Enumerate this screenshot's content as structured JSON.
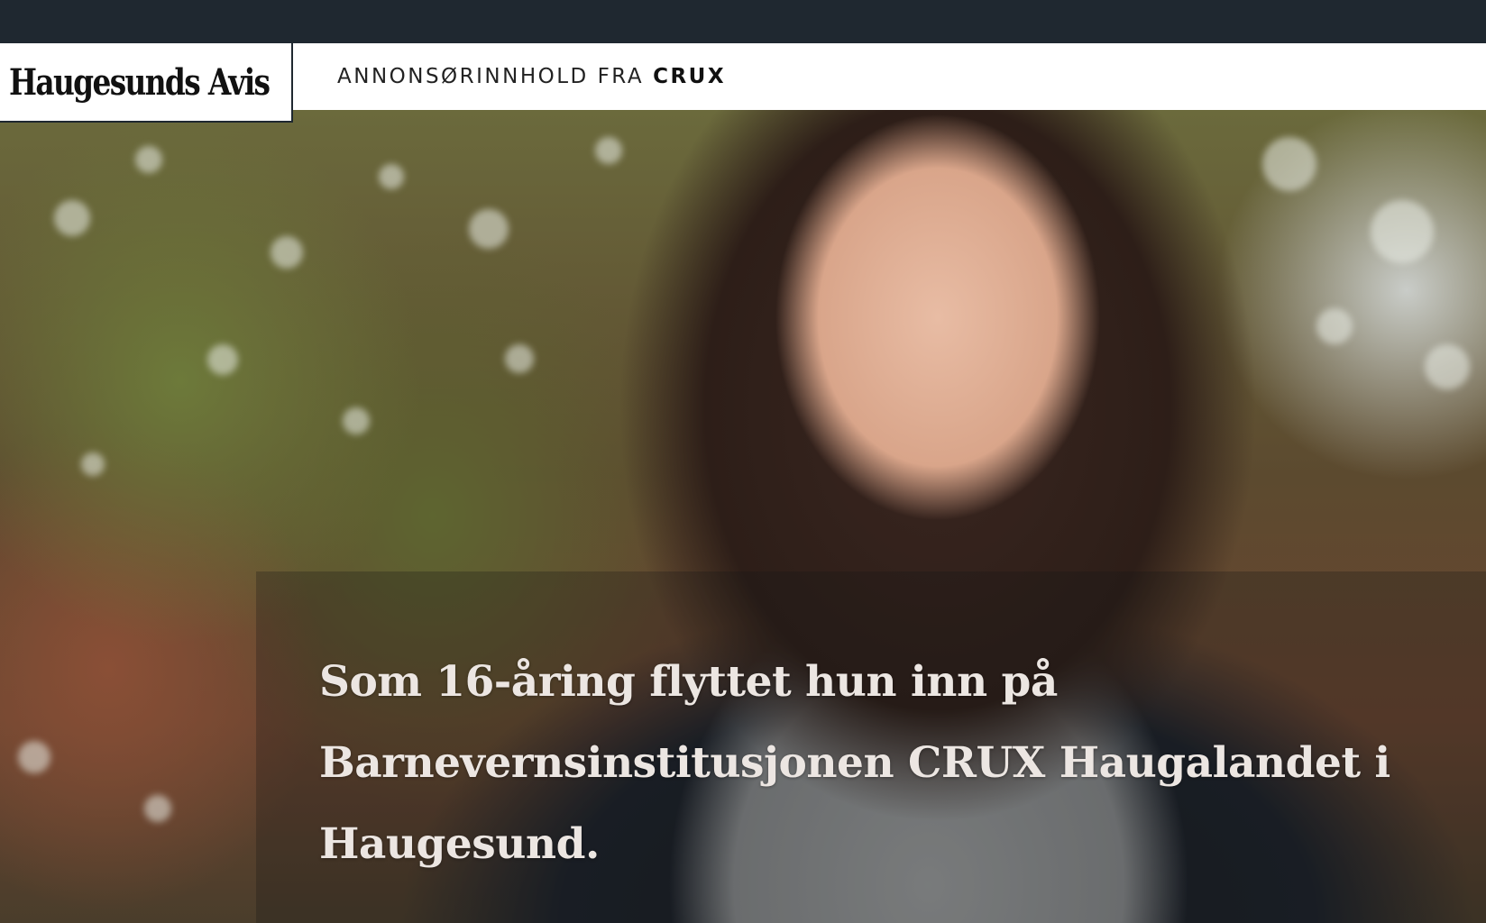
{
  "site": {
    "logo_text": "Haugesunds Avis"
  },
  "sponsor": {
    "prefix": "ANNONSØRINNHOLD FRA",
    "brand": "CRUX"
  },
  "article": {
    "headline": "Som 16-åring flyttet hun inn på Barnevernsinstitusjonen CRUX Haugalandet i Haugesund."
  }
}
